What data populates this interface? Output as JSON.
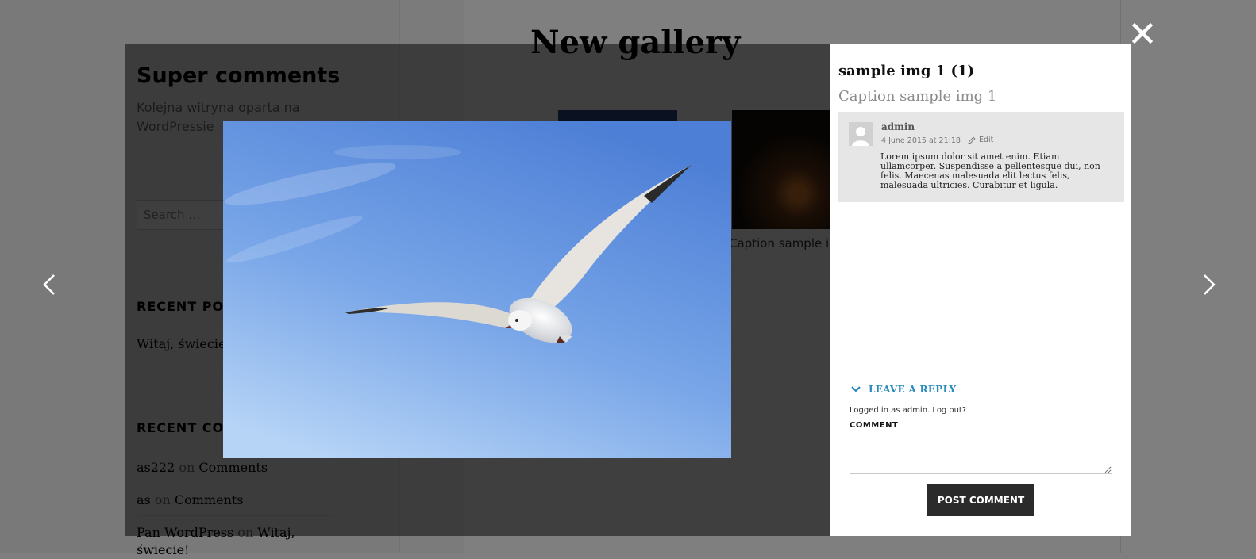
{
  "background_page": {
    "site_title": "Super comments",
    "site_description": "Kolejna witryna oparta na WordPressie",
    "search_placeholder": "Search …",
    "page_title": "New gallery",
    "thumb_caption": "Caption sample i",
    "recent_posts_title": "RECENT POST",
    "recent_post_item": "Witaj, świecie!",
    "recent_comments_title": "RECENT COM",
    "recent_comments": [
      {
        "author": "as222",
        "on": "on",
        "post": "Comments"
      },
      {
        "author": "as",
        "on": "on",
        "post": "Comments"
      },
      {
        "author": "Pan WordPress",
        "on": "on",
        "post": "Witaj, świecie!"
      }
    ]
  },
  "lightbox": {
    "image_alt": "Seagull flying in blue sky",
    "prev_icon": "chevron-left-icon",
    "next_icon": "chevron-right-icon",
    "close_icon": "close-icon"
  },
  "panel": {
    "image_title": "sample img 1 (1)",
    "image_caption": "Caption sample img 1",
    "comment": {
      "author": "admin",
      "date": "4 June 2015 at 21:18",
      "edit_label": "Edit",
      "text": "Lorem ipsum dolor sit amet enim. Etiam ullamcorper. Suspendisse a pellentesque dui, non felis. Maecenas malesuada elit lectus felis, malesuada ultricies. Curabitur et ligula."
    },
    "reply": {
      "heading": "LEAVE A REPLY",
      "logged_in_prefix": "Logged in as",
      "logged_in_user": "admin",
      "logout_label": "Log out?",
      "comment_label": "COMMENT",
      "submit_label": "POST COMMENT"
    }
  },
  "colors": {
    "reply_accent": "#2a8bbd",
    "button_bg": "#2b2b2b",
    "comment_box_bg": "#e6e6e6"
  }
}
